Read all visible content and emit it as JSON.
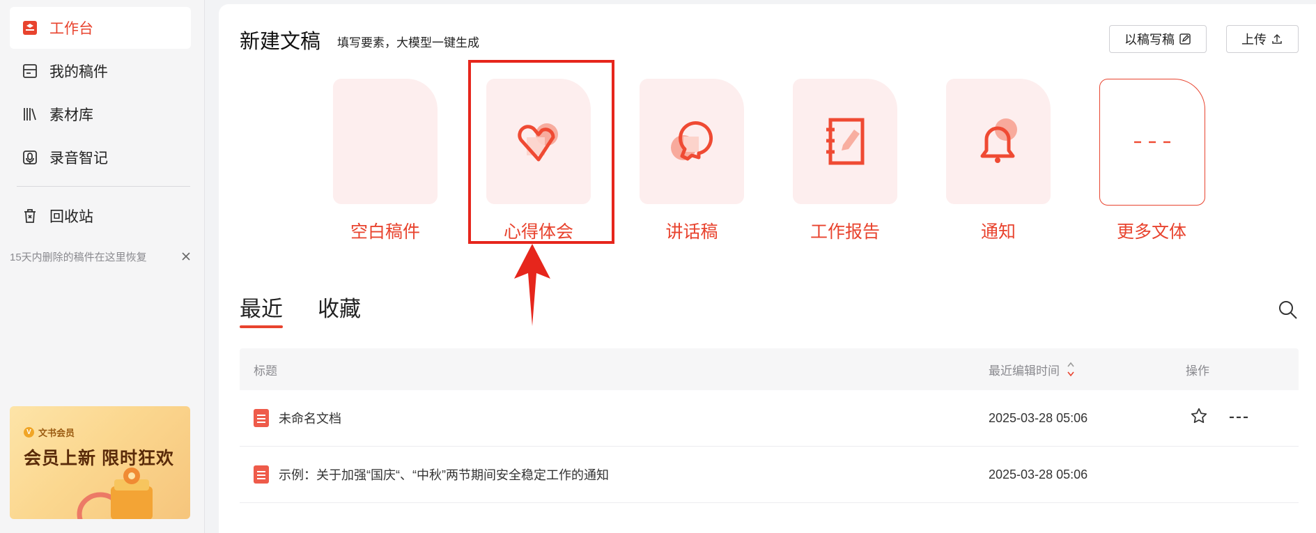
{
  "sidebar": {
    "items": [
      {
        "label": "工作台",
        "icon": "workbench-icon"
      },
      {
        "label": "我的稿件",
        "icon": "drafts-icon"
      },
      {
        "label": "素材库",
        "icon": "library-icon"
      },
      {
        "label": "录音智记",
        "icon": "recorder-icon"
      },
      {
        "label": "回收站",
        "icon": "trash-icon"
      }
    ],
    "recycle_hint": "15天内删除的稿件在这里恢复",
    "promo": {
      "badge": "文书会员",
      "headline": "会员上新 限时狂欢"
    }
  },
  "header": {
    "title": "新建文稿",
    "subtitle": "填写要素，大模型一键生成",
    "btn_rewrite": "以稿写稿",
    "btn_upload": "上传"
  },
  "templates": [
    {
      "label": "空白稿件",
      "icon": "blank-icon"
    },
    {
      "label": "心得体会",
      "icon": "heart-icon"
    },
    {
      "label": "讲话稿",
      "icon": "speech-icon"
    },
    {
      "label": "工作报告",
      "icon": "report-icon"
    },
    {
      "label": "通知",
      "icon": "bell-icon"
    },
    {
      "label": "更多文体",
      "icon": "more-icon"
    }
  ],
  "tabs": [
    {
      "label": "最近"
    },
    {
      "label": "收藏"
    }
  ],
  "table": {
    "headers": {
      "title": "标题",
      "time": "最近编辑时间",
      "action": "操作"
    },
    "rows": [
      {
        "title": "未命名文档",
        "time": "2025-03-28 05:06"
      },
      {
        "title": "示例：关于加强“国庆“、“中秋”两节期间安全稳定工作的通知",
        "time": "2025-03-28 05:06"
      }
    ]
  },
  "colors": {
    "accent": "#e8432e",
    "card_bg": "#fdeeee",
    "highlight": "#e6261c"
  }
}
